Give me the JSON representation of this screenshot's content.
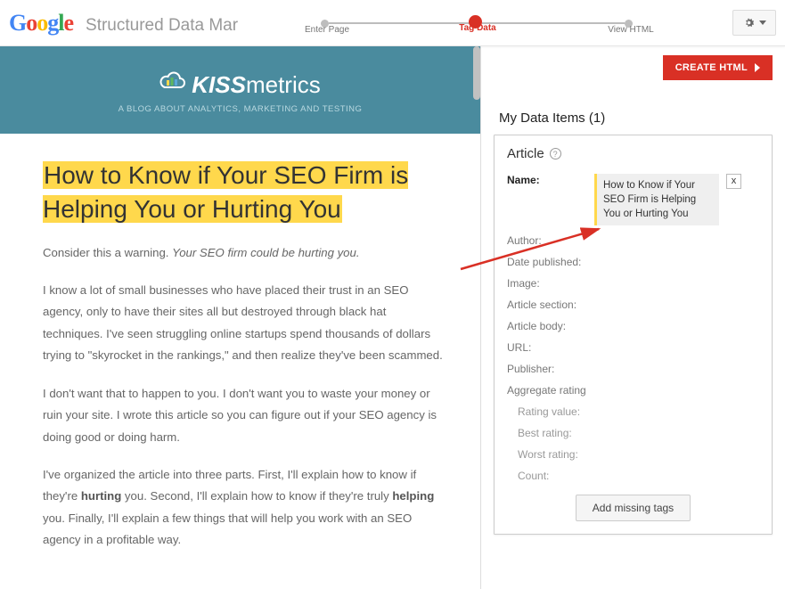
{
  "header": {
    "app_title": "Structured Data Mar",
    "steps": [
      "Enter Page",
      "Tag Data",
      "View HTML"
    ],
    "active_step": 1
  },
  "content": {
    "km_tagline": "A BLOG ABOUT ANALYTICS, MARKETING AND TESTING",
    "title": "How to Know if Your SEO Firm is Helping You or Hurting You",
    "p1_a": "Consider this a warning. ",
    "p1_b": "Your SEO firm could be hurting you.",
    "p2": "I know a lot of small businesses who have placed their trust in an SEO agency, only to have their sites all but destroyed through black hat techniques. I've seen struggling online startups spend thousands of dollars trying to \"skyrocket in the rankings,\" and then realize they've been scammed.",
    "p3": "I don't want that to happen to you. I don't want you to waste your money or ruin your site. I wrote this article so you can figure out if your SEO agency is doing good or doing harm.",
    "p4_a": "I've organized the article into three parts. First, I'll explain how to know if they're ",
    "p4_b": "hurting",
    "p4_c": " you. Second, I'll explain how to know if they're truly ",
    "p4_d": "helping",
    "p4_e": " you. Finally, I'll explain a few things that will help you work with an SEO agency in a profitable way."
  },
  "side": {
    "create_btn": "CREATE HTML",
    "title": "My Data Items (1)",
    "card_title": "Article",
    "name_value": "How to Know if Your SEO Firm is Helping You or Hurting You",
    "fields": {
      "name": "Name:",
      "author": "Author:",
      "date_published": "Date published:",
      "image": "Image:",
      "article_section": "Article section:",
      "article_body": "Article body:",
      "url": "URL:",
      "publisher": "Publisher:",
      "aggregate_rating": "Aggregate rating",
      "rating_value": "Rating value:",
      "best_rating": "Best rating:",
      "worst_rating": "Worst rating:",
      "count": "Count:"
    },
    "add_tags": "Add missing tags"
  }
}
